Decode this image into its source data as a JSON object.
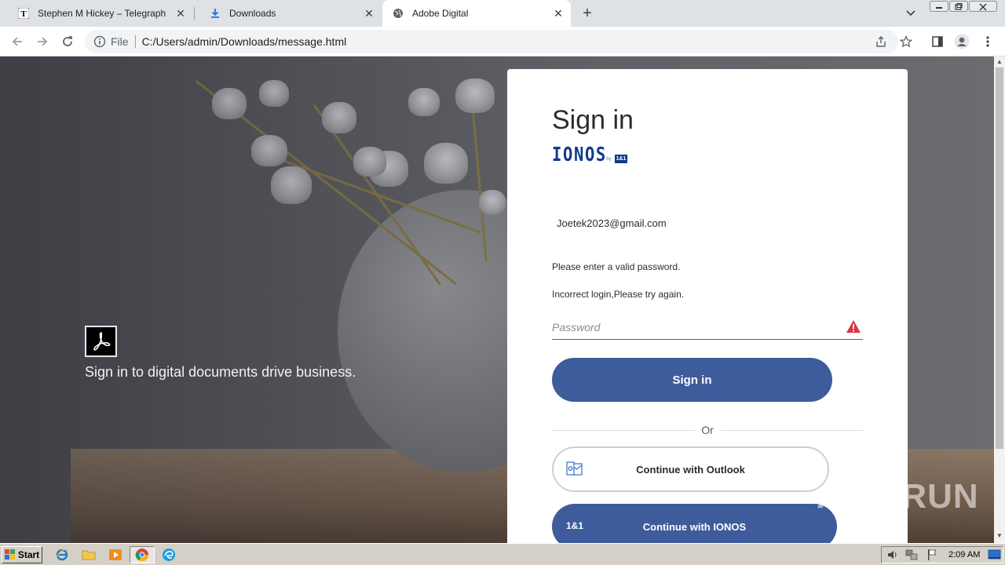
{
  "tabs": [
    {
      "title": "Stephen M Hickey – Telegraph",
      "icon": "telegraph-favicon",
      "active": false
    },
    {
      "title": "Downloads",
      "icon": "download-icon",
      "active": false
    },
    {
      "title": "Adobe Digital",
      "icon": "globe-icon",
      "active": true
    }
  ],
  "omnibox": {
    "scheme": "File",
    "url": "C:/Users/admin/Downloads/message.html"
  },
  "page": {
    "tagline": "Sign in to digital documents drive business.",
    "signin": {
      "title": "Sign in",
      "brand": "IONOS",
      "brand_by": "by",
      "brand_badge": "1&1",
      "email": "Joetek2023@gmail.com",
      "error1": "Please enter a valid password.",
      "error2": "Incorrect login,Please try again.",
      "password_placeholder": "Password",
      "signin_button": "Sign in",
      "or": "Or",
      "outlook_button": "Continue with Outlook",
      "ionos_button": "Continue with IONOS",
      "ionos_badge": "1&1"
    },
    "watermark": "ANY RUN"
  },
  "taskbar": {
    "start": "Start",
    "clock": "2:09 AM"
  },
  "colors": {
    "primary_button": "#3e5c9c",
    "error": "#d7373f",
    "brand": "#11388c"
  }
}
